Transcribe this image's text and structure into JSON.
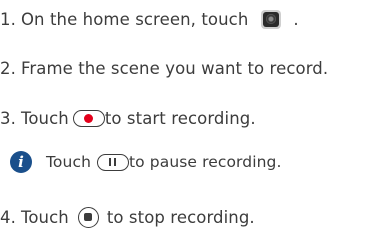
{
  "steps": [
    {
      "number": "1.",
      "text_before": "On the home screen, touch",
      "text_after": "."
    },
    {
      "number": "2.",
      "text": "Frame the scene you want to record."
    },
    {
      "number": "3.",
      "text_before": "Touch",
      "text_after": "to start recording."
    },
    {
      "number": "4.",
      "text_before": "Touch",
      "text_after": "to stop recording."
    }
  ],
  "note": {
    "icon_glyph": "i",
    "text_before": "Touch",
    "text_after": "to pause recording."
  },
  "icons": {
    "camera": "camera-app-icon",
    "record": "record-button-icon",
    "pause": "pause-button-icon",
    "stop": "stop-button-icon",
    "info": "info-icon"
  },
  "colors": {
    "text": "#3c3c3c",
    "record_dot": "#e3001b",
    "info_badge": "#1a4f8b"
  }
}
